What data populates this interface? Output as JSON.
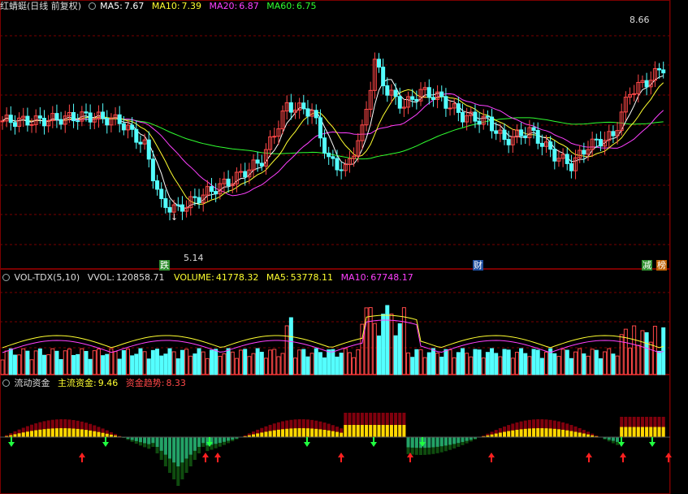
{
  "colors": {
    "bg": "#000000",
    "grid": "#7a0000",
    "up": "#ff4848",
    "down": "#54ffff",
    "ma5": "#ffffff",
    "ma10": "#ffff30",
    "ma20": "#ff40ff",
    "ma60": "#30ff30"
  },
  "price_panel": {
    "title": "红蜻蜓(日线 前复权)",
    "ma5": {
      "label": "MA5:",
      "value": "7.67"
    },
    "ma10": {
      "label": "MA10:",
      "value": "7.39"
    },
    "ma20": {
      "label": "MA20:",
      "value": "6.87"
    },
    "ma60": {
      "label": "MA60:",
      "value": "6.75"
    },
    "high_label": "8.66",
    "low_label": "5.14",
    "markers": [
      {
        "text": "跌",
        "color": "#2f8f2f"
      },
      {
        "text": "财",
        "color": "#1f4f9f"
      },
      {
        "text": "减",
        "color": "#2f8f2f"
      },
      {
        "text": "榜",
        "color": "#c06000"
      }
    ],
    "y_range": [
      4.2,
      9.2
    ]
  },
  "volume_panel": {
    "title": "VOL-TDX(5,10)",
    "vvol": {
      "label": "VVOL:",
      "value": "120858.71"
    },
    "volume": {
      "label": "VOLUME:",
      "value": "41778.32"
    },
    "ma5": {
      "label": "MA5:",
      "value": "53778.11"
    },
    "ma10": {
      "label": "MA10:",
      "value": "67748.17"
    }
  },
  "flow_panel": {
    "title": "流动资金",
    "main_fund": {
      "label": "主流资金:",
      "value": "9.46"
    },
    "trend": {
      "label": "资金趋势:",
      "value": "8.33"
    }
  }
}
